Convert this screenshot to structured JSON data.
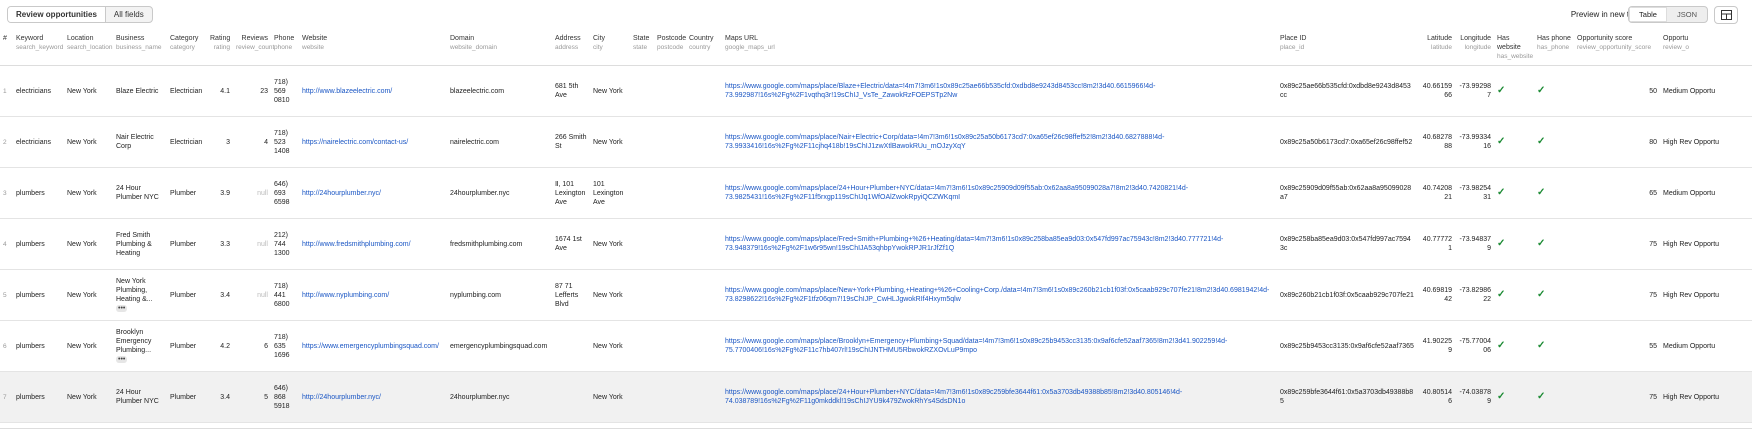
{
  "toolbar": {
    "tabs": [
      {
        "label": "Review opportunities"
      },
      {
        "label": "All fields"
      }
    ],
    "preview_label": "Preview in new tab",
    "view_options": [
      {
        "label": "Table"
      },
      {
        "label": "JSON"
      }
    ],
    "settings_icon": "columns-icon"
  },
  "columns": [
    {
      "title": "#",
      "key": ""
    },
    {
      "title": "Keyword",
      "key": "search_keyword"
    },
    {
      "title": "Location",
      "key": "search_location"
    },
    {
      "title": "Business",
      "key": "business_name"
    },
    {
      "title": "Category",
      "key": "category"
    },
    {
      "title": "Rating",
      "key": "rating"
    },
    {
      "title": "Reviews",
      "key": "review_count"
    },
    {
      "title": "Phone",
      "key": "phone"
    },
    {
      "title": "Website",
      "key": "website"
    },
    {
      "title": "Domain",
      "key": "website_domain"
    },
    {
      "title": "Address",
      "key": "address"
    },
    {
      "title": "City",
      "key": "city"
    },
    {
      "title": "State",
      "key": "state"
    },
    {
      "title": "Postcode",
      "key": "postcode"
    },
    {
      "title": "Country",
      "key": "country"
    },
    {
      "title": "Maps URL",
      "key": "google_maps_url"
    },
    {
      "title": "Place ID",
      "key": "place_id"
    },
    {
      "title": "Latitude",
      "key": "latitude"
    },
    {
      "title": "Longitude",
      "key": "longitude"
    },
    {
      "title": "Has website",
      "key": "has_website"
    },
    {
      "title": "Has phone",
      "key": "has_phone"
    },
    {
      "title": "Opportunity score",
      "key": "review_opportunity_score"
    },
    {
      "title": "Opportu",
      "key": "review_o"
    }
  ],
  "rows": [
    {
      "idx": "1",
      "keyword": "electricians",
      "location": "New York",
      "business": "Blaze Electric",
      "more": "",
      "category": "Electrician",
      "rating": "4.1",
      "reviews": "23",
      "phone": "718) 569 0810",
      "website": "http://www.blazeelectric.com/",
      "domain": "blazeelectric.com",
      "address": "681 5th Ave",
      "city": "New York",
      "state": "",
      "postcode": "",
      "country": "",
      "maps_url": "https://www.google.com/maps/place/Blaze+Electric/data=!4m7!3m6!1s0x89c25ae66b535cfd:0xdbd8e9243d8453cc!8m2!3d40.6615966!4d-73.992987!16s%2Fg%2F1vqthq3r!19sChIJ_VsTe_ZawokRzFOEPSTp2Nw",
      "place_id": "0x89c25ae66b535cfd:0xdbd8e9243d8453cc",
      "latitude": "40.6615966",
      "longitude": "-73.992987",
      "has_website": true,
      "has_phone": true,
      "score": "50",
      "opp": "Medium Opportu"
    },
    {
      "idx": "2",
      "keyword": "electricians",
      "location": "New York",
      "business": "Nair Electric Corp",
      "more": "",
      "category": "Electrician",
      "rating": "3",
      "reviews": "4",
      "phone": "718) 523 1408",
      "website": "https://nairelectric.com/contact-us/",
      "domain": "nairelectric.com",
      "address": "266 Smith St",
      "city": "New York",
      "state": "",
      "postcode": "",
      "country": "",
      "maps_url": "https://www.google.com/maps/place/Nair+Electric+Corp/data=!4m7!3m6!1s0x89c25a50b6173cd7:0xa65ef26c98ffef52!8m2!3d40.6827888!4d-73.9933416!16s%2Fg%2F11cjhq418b!19sChIJ1zwXtlBawokRUu_mOJzyXqY",
      "place_id": "0x89c25a50b6173cd7:0xa65ef26c98ffef52",
      "latitude": "40.6827888",
      "longitude": "-73.9933416",
      "has_website": true,
      "has_phone": true,
      "score": "80",
      "opp": "High Rev Opportu"
    },
    {
      "idx": "3",
      "keyword": "plumbers",
      "location": "New York",
      "business": "24 Hour Plumber NYC",
      "more": "",
      "category": "Plumber",
      "rating": "3.9",
      "reviews": "null",
      "phone": "646) 693 6598",
      "website": "http://24hourplumber.nyc/",
      "domain": "24hourplumber.nyc",
      "address": "Ⅱ, 101 Lexington Ave",
      "city": "101 Lexington Ave",
      "state": "",
      "postcode": "",
      "country": "",
      "maps_url": "https://www.google.com/maps/place/24+Hour+Plumber+NYC/data=!4m7!3m6!1s0x89c25909d09f55ab:0x62aa8a95099028a7!8m2!3d40.7420821!4d-73.9825431!16s%2Fg%2F11f5rxgp119sChIJq1WfOAlZwokRpyiQCZWKqmI",
      "place_id": "0x89c25909d09f55ab:0x62aa8a95099028a7",
      "latitude": "40.7420821",
      "longitude": "-73.9825431",
      "has_website": true,
      "has_phone": true,
      "score": "65",
      "opp": "Medium Opportu"
    },
    {
      "idx": "4",
      "keyword": "plumbers",
      "location": "New York",
      "business": "Fred Smith Plumbing & Heating",
      "more": "",
      "category": "Plumber",
      "rating": "3.3",
      "reviews": "null",
      "phone": "212) 744 1300",
      "website": "http://www.fredsmithplumbing.com/",
      "domain": "fredsmithplumbing.com",
      "address": "1674 1st Ave",
      "city": "New York",
      "state": "",
      "postcode": "",
      "country": "",
      "maps_url": "https://www.google.com/maps/place/Fred+Smith+Plumbing+%26+Heating/data=!4m7!3m6!1s0x89c258ba85ea9d03:0x547fd997ac75943c!8m2!3d40.777721!4d-73.948379!16s%2Fg%2F1w6r95wn!19sChIJA53qhbpYwokRPJR1rJfZf1Q",
      "place_id": "0x89c258ba85ea9d03:0x547fd997ac75943c",
      "latitude": "40.777721",
      "longitude": "-73.948379",
      "has_website": true,
      "has_phone": true,
      "score": "75",
      "opp": "High Rev Opportu"
    },
    {
      "idx": "5",
      "keyword": "plumbers",
      "location": "New York",
      "business": "New York Plumbing, Heating &...",
      "more": "•••",
      "category": "Plumber",
      "rating": "3.4",
      "reviews": "null",
      "phone": "718) 441 6800",
      "website": "http://www.nyplumbing.com/",
      "domain": "nyplumbing.com",
      "address": "87 71 Lefferts Blvd",
      "city": "New York",
      "state": "",
      "postcode": "",
      "country": "",
      "maps_url": "https://www.google.com/maps/place/New+York+Plumbing,+Heating+%26+Cooling+Corp./data=!4m7!3m6!1s0x89c260b21cb1f03f:0x5caab929c707fe21!8m2!3d40.6981942!4d-73.8298622!16s%2Fg%2F1tfz06qm7!19sChIJP_CwHLJgwokRIf4Hxym5qlw",
      "place_id": "0x89c260b21cb1f03f:0x5caab929c707fe21",
      "latitude": "40.6981942",
      "longitude": "-73.8298622",
      "has_website": true,
      "has_phone": true,
      "score": "75",
      "opp": "High Rev Opportu"
    },
    {
      "idx": "6",
      "keyword": "plumbers",
      "location": "New York",
      "business": "Brooklyn Emergency Plumbing...",
      "more": "•••",
      "category": "Plumber",
      "rating": "4.2",
      "reviews": "6",
      "phone": "718) 635 1696",
      "website": "https://www.emergencyplumbingsquad.com/",
      "domain": "emergencyplumbingsquad.com",
      "address": "",
      "city": "New York",
      "state": "",
      "postcode": "",
      "country": "",
      "maps_url": "https://www.google.com/maps/place/Brooklyn+Emergency+Plumbing+Squad/data=!4m7!3m6!1s0x89c25b9453cc3135:0x9af6cfe52aaf7365!8m2!3d41.902259!4d-75.7700406!16s%2Fg%2F11c7hb407rl!19sChIJNTHMU5RbwokRZXOvLuP9mpo",
      "place_id": "0x89c25b9453cc3135:0x9af6cfe52aaf7365",
      "latitude": "41.902259",
      "longitude": "-75.7700406",
      "has_website": true,
      "has_phone": true,
      "score": "55",
      "opp": "Medium Opportu"
    },
    {
      "idx": "7",
      "keyword": "plumbers",
      "location": "New York",
      "business": "24 Hour Plumber NYC",
      "more": "",
      "category": "Plumber",
      "rating": "3.4",
      "reviews": "5",
      "phone": "646) 868 5918",
      "website": "http://24hourplumber.nyc/",
      "domain": "24hourplumber.nyc",
      "address": "",
      "city": "New York",
      "state": "",
      "postcode": "",
      "country": "",
      "maps_url": "https://www.google.com/maps/place/24+Hour+Plumber+NYC/data=!4m7!3m6!1s0x89c259bfe3644f61:0x5a3703db49388b85!8m2!3d40.805146!4d-74.038789!16s%2Fg%2F11g0mkddkl!19sChIJYU9k479ZwokRhYs4SdsDN1o",
      "place_id": "0x89c259bfe3644f61:0x5a3703db49388b85",
      "latitude": "40.805146",
      "longitude": "-74.038789",
      "has_website": true,
      "has_phone": true,
      "score": "75",
      "opp": "High Rev Opportu"
    }
  ]
}
